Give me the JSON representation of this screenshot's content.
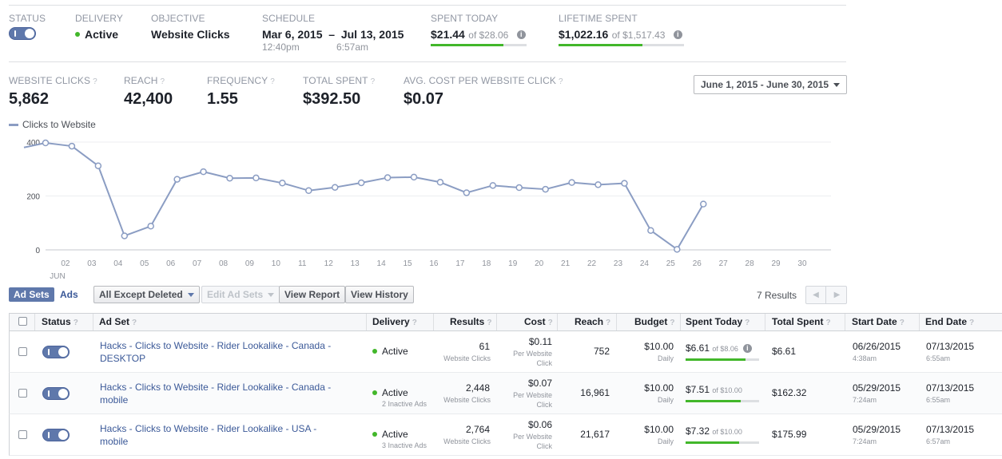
{
  "summary": {
    "status_label": "STATUS",
    "delivery_label": "DELIVERY",
    "delivery_value": "Active",
    "objective_label": "OBJECTIVE",
    "objective_value": "Website Clicks",
    "schedule_label": "SCHEDULE",
    "schedule_value": "Mar 6, 2015  –  Jul 13, 2015",
    "schedule_start_time": "12:40pm",
    "schedule_end_time": "6:57am",
    "spent_today_label": "SPENT TODAY",
    "spent_today_value": "$21.44",
    "spent_today_of": "of $28.06",
    "spent_today_progress": 0.76,
    "lifetime_label": "LIFETIME SPENT",
    "lifetime_value": "$1,022.16",
    "lifetime_of": "of $1,517.43",
    "lifetime_progress": 0.67
  },
  "metrics": [
    {
      "label": "WEBSITE CLICKS",
      "value": "5,862"
    },
    {
      "label": "REACH",
      "value": "42,400"
    },
    {
      "label": "FREQUENCY",
      "value": "1.55"
    },
    {
      "label": "TOTAL SPENT",
      "value": "$392.50"
    },
    {
      "label": "AVG. COST PER WEBSITE CLICK",
      "value": "$0.07"
    }
  ],
  "date_range": "June 1, 2015 - June 30, 2015",
  "chart_data": {
    "type": "line",
    "legend": "Clicks to Website",
    "series": [
      {
        "name": "Clicks to Website",
        "x": [
          1,
          2,
          3,
          4,
          5,
          6,
          7,
          8,
          9,
          10,
          11,
          12,
          13,
          14,
          15,
          16,
          17,
          18,
          19,
          20,
          21,
          22,
          23,
          24,
          25,
          26
        ],
        "values": [
          397,
          385,
          312,
          52,
          88,
          262,
          290,
          266,
          267,
          248,
          220,
          232,
          249,
          268,
          270,
          251,
          212,
          239,
          231,
          225,
          250,
          242,
          247,
          72,
          2,
          170
        ]
      }
    ],
    "x_tick_labels": [
      "02",
      "03",
      "04",
      "05",
      "06",
      "07",
      "08",
      "09",
      "10",
      "11",
      "12",
      "13",
      "14",
      "15",
      "16",
      "17",
      "18",
      "19",
      "20",
      "21",
      "22",
      "23",
      "24",
      "25",
      "26",
      "27",
      "28",
      "29",
      "30"
    ],
    "x_month_label": "JUN",
    "y_ticks": [
      0,
      200,
      400
    ],
    "xlim": [
      1,
      30
    ],
    "ylim": [
      0,
      400
    ],
    "grid": true
  },
  "toolbar": {
    "tab_adsets": "Ad Sets",
    "tab_ads": "Ads",
    "filter": "All Except Deleted",
    "edit": "Edit Ad Sets",
    "view_report": "View Report",
    "view_history": "View History",
    "results": "7 Results"
  },
  "table": {
    "headers": [
      "Status",
      "Ad Set",
      "Delivery",
      "Results",
      "Cost",
      "Reach",
      "Budget",
      "Spent Today",
      "Total Spent",
      "Start Date",
      "End Date"
    ],
    "rows": [
      {
        "name_line1": "Hacks - Clicks to Website - Rider Lookalike - Canada -",
        "name_line2": "DESKTOP",
        "delivery": "Active",
        "delivery_sub": "",
        "results": "61",
        "results_sub": "Website Clicks",
        "cost": "$0.11",
        "cost_sub1": "Per Website",
        "cost_sub2": "Click",
        "reach": "752",
        "budget": "$10.00",
        "budget_sub": "Daily",
        "spent": "$6.61",
        "spent_of": "of $8.06",
        "spent_progress": 0.82,
        "total": "$6.61",
        "start": "06/26/2015",
        "start_time": "4:38am",
        "end": "07/13/2015",
        "end_time": "6:55am"
      },
      {
        "name_line1": "Hacks - Clicks to Website - Rider Lookalike - Canada -",
        "name_line2": "mobile",
        "delivery": "Active",
        "delivery_sub": "2 Inactive Ads",
        "results": "2,448",
        "results_sub": "Website Clicks",
        "cost": "$0.07",
        "cost_sub1": "Per Website",
        "cost_sub2": "Click",
        "reach": "16,961",
        "budget": "$10.00",
        "budget_sub": "Daily",
        "spent": "$7.51",
        "spent_of": "of $10.00",
        "spent_progress": 0.75,
        "total": "$162.32",
        "start": "05/29/2015",
        "start_time": "7:24am",
        "end": "07/13/2015",
        "end_time": "6:55am"
      },
      {
        "name_line1": "Hacks - Clicks to Website - Rider Lookalike - USA -",
        "name_line2": "mobile",
        "delivery": "Active",
        "delivery_sub": "3 Inactive Ads",
        "results": "2,764",
        "results_sub": "Website Clicks",
        "cost": "$0.06",
        "cost_sub1": "Per Website",
        "cost_sub2": "Click",
        "reach": "21,617",
        "budget": "$10.00",
        "budget_sub": "Daily",
        "spent": "$7.32",
        "spent_of": "of $10.00",
        "spent_progress": 0.73,
        "total": "$175.99",
        "start": "05/29/2015",
        "start_time": "7:24am",
        "end": "07/13/2015",
        "end_time": "6:57am"
      }
    ]
  },
  "colors": {
    "accent": "#5f78ab",
    "line": "#8b9dc3",
    "progress": "#42b72a",
    "link": "#3b5998"
  }
}
